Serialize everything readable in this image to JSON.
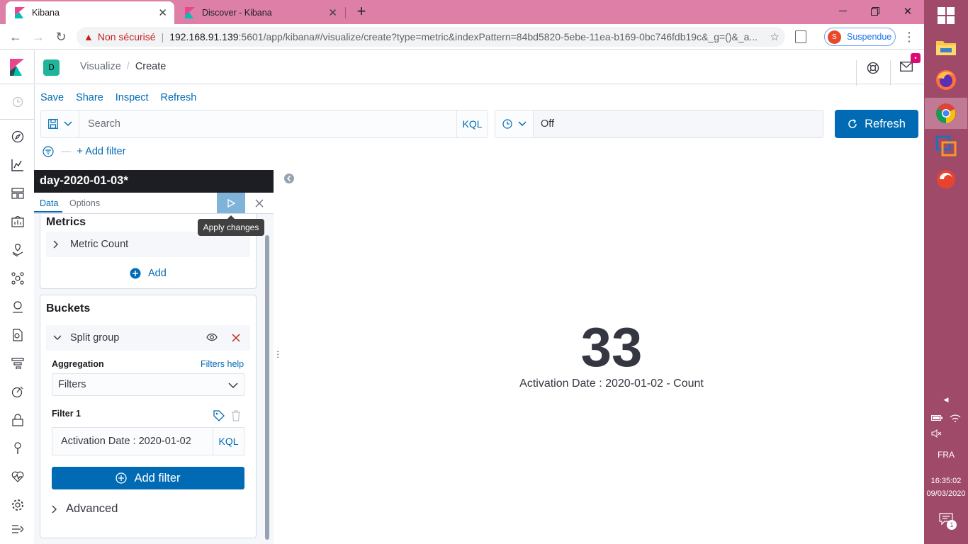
{
  "browser": {
    "tabs": [
      {
        "title": "Kibana",
        "active": true
      },
      {
        "title": "Discover - Kibana",
        "active": false
      }
    ],
    "security_label": "Non sécurisé",
    "url_host": "192.168.91.139",
    "url_rest": ":5601/app/kibana#/visualize/create?type=metric&indexPattern=84bd5820-5ebe-11ea-b169-0bc746fdb19c&_g=()&_a...",
    "profile": {
      "initial": "S",
      "status": "Suspendue"
    }
  },
  "kibana": {
    "space_initial": "D",
    "breadcrumbs": [
      "Visualize",
      "Create"
    ],
    "top_menu": [
      "Save",
      "Share",
      "Inspect",
      "Refresh"
    ],
    "search_placeholder": "Search",
    "query_language": "KQL",
    "date_value": "Off",
    "refresh_label": "Refresh",
    "add_filter_label": "+ Add filter",
    "mail_badge": "•"
  },
  "editor": {
    "title": "day-2020-01-03*",
    "tabs": [
      "Data",
      "Options"
    ],
    "tooltip": "Apply changes",
    "metrics": {
      "heading": "Metrics",
      "item": "Metric Count",
      "add_label": "Add"
    },
    "buckets": {
      "heading": "Buckets",
      "item": "Split group",
      "aggregation_label": "Aggregation",
      "help_link": "Filters help",
      "aggregation_value": "Filters",
      "filter_label": "Filter 1",
      "filter_value": "Activation Date : 2020-01-02",
      "filter_language": "KQL",
      "add_filter_button": "Add filter",
      "advanced_label": "Advanced"
    }
  },
  "visualization": {
    "value": "33",
    "label": "Activation Date : 2020-01-02 - Count"
  },
  "taskbar": {
    "language": "FRA",
    "time": "16:35:02",
    "date": "09/03/2020",
    "notification_count": "1"
  },
  "colors": {
    "accent": "#006bb4",
    "tab_strip": "#dd7fa6",
    "taskbar": "#a04a6a",
    "editor_title_bg": "#1d1e24"
  }
}
